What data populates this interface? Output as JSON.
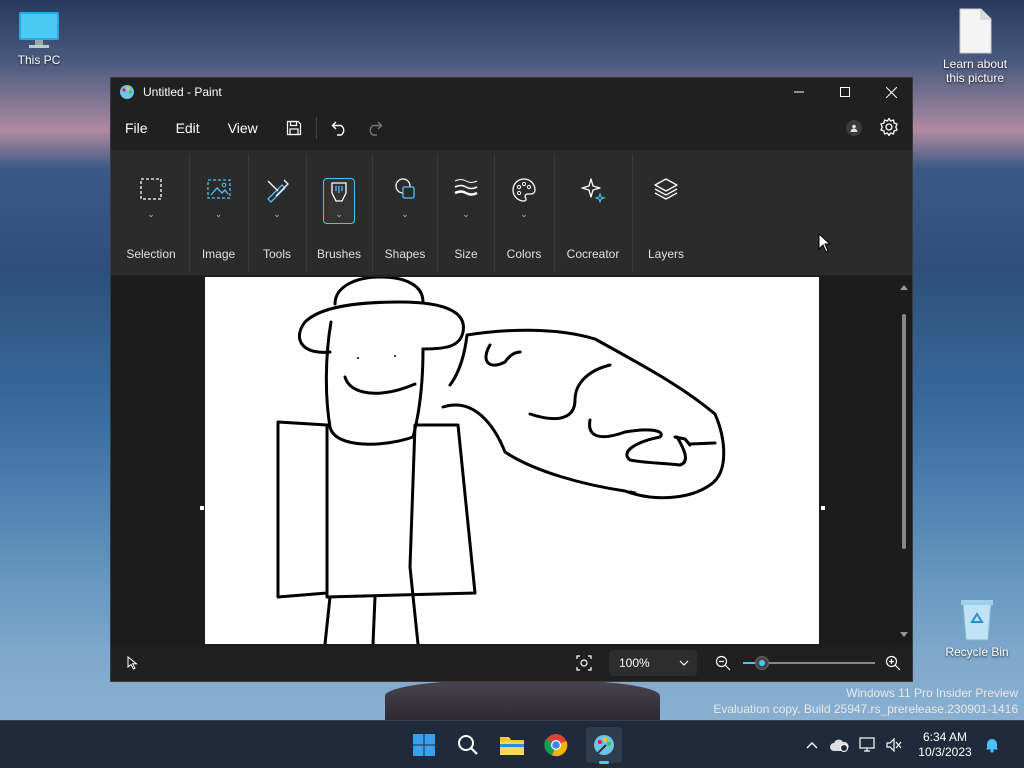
{
  "desktop": {
    "this_pc_label": "This PC",
    "learn_label_line1": "Learn about",
    "learn_label_line2": "this picture",
    "recycle_bin_label": "Recycle Bin"
  },
  "window": {
    "title": "Untitled - Paint",
    "controls": {
      "minimize": "minimize-icon",
      "maximize": "maximize-icon",
      "close": "close-icon"
    }
  },
  "menu": {
    "file": "File",
    "edit": "Edit",
    "view": "View"
  },
  "ribbon": {
    "groups": [
      {
        "label": "Selection",
        "icon": "selection-icon"
      },
      {
        "label": "Image",
        "icon": "image-icon"
      },
      {
        "label": "Tools",
        "icon": "tools-icon"
      },
      {
        "label": "Brushes",
        "icon": "brush-icon",
        "active": true
      },
      {
        "label": "Shapes",
        "icon": "shapes-icon"
      },
      {
        "label": "Size",
        "icon": "size-icon"
      },
      {
        "label": "Colors",
        "icon": "palette-icon"
      },
      {
        "label": "Cocreator",
        "icon": "sparkle-icon"
      },
      {
        "label": "Layers",
        "icon": "layers-icon"
      }
    ]
  },
  "status": {
    "zoom_level": "100%",
    "zoom_slider_fraction": 0.17
  },
  "watermark": {
    "line1": "Windows 11 Pro Insider Preview",
    "line2": "Evaluation copy. Build 25947.rs_prerelease.230901-1416"
  },
  "taskbar": {
    "time": "6:34 AM",
    "date": "10/3/2023",
    "apps": [
      "start-icon",
      "search-icon",
      "file-explorer-icon",
      "chrome-icon",
      "paint-icon"
    ]
  },
  "colors": {
    "accent": "#4cc2ff",
    "window_bg": "#202020",
    "ribbon_bg": "#2b2b2b"
  }
}
